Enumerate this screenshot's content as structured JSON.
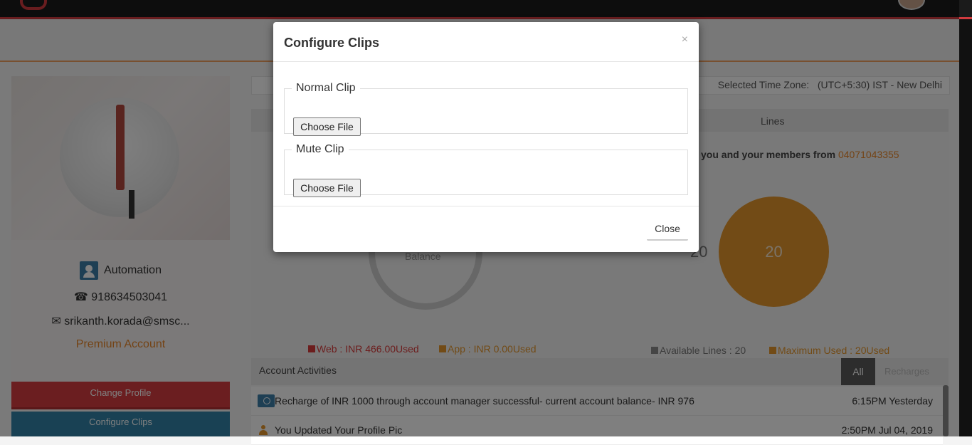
{
  "profile": {
    "name": "Automation",
    "phone": "918634503041",
    "email": "srikanth.korada@smsc...",
    "account_type": "Premium Account",
    "change_profile_label": "Change Profile",
    "configure_clips_label": "Configure Clips"
  },
  "timezone": {
    "label": "Selected Time Zone:",
    "value": "(UTC+5:30) IST - New Delhi"
  },
  "tabs": {
    "lines": "Lines"
  },
  "balance": {
    "label": "Balance",
    "web": "Web : INR 466.00Used",
    "app": "App : INR 0.00Used"
  },
  "lines": {
    "members_text": "you and your members from",
    "number": "04071043355",
    "left_value": "20",
    "circle_value": "20",
    "available": "Available Lines : 20",
    "maximum": "Maximum Used : 20Used"
  },
  "activities": {
    "title": "Account Activities",
    "tab_all": "All",
    "tab_recharges": "Recharges",
    "rows": [
      {
        "text": "Recharge of INR 1000 through account manager successful- current account balance- INR 976",
        "time": "6:15PM Yesterday"
      },
      {
        "text": "You Updated Your Profile Pic",
        "time": "2:50PM Jul 04, 2019"
      }
    ]
  },
  "modal": {
    "title": "Configure Clips",
    "close_x": "×",
    "normal_clip_legend": "Normal Clip",
    "mute_clip_legend": "Mute Clip",
    "choose_file_label": "Choose File",
    "close_label": "Close"
  },
  "colors": {
    "accent_red": "#d73d41",
    "accent_blue": "#3283a8",
    "accent_orange": "#e5962c",
    "web_legend": "#d93b3b",
    "available_legend": "#8a8a8a"
  }
}
